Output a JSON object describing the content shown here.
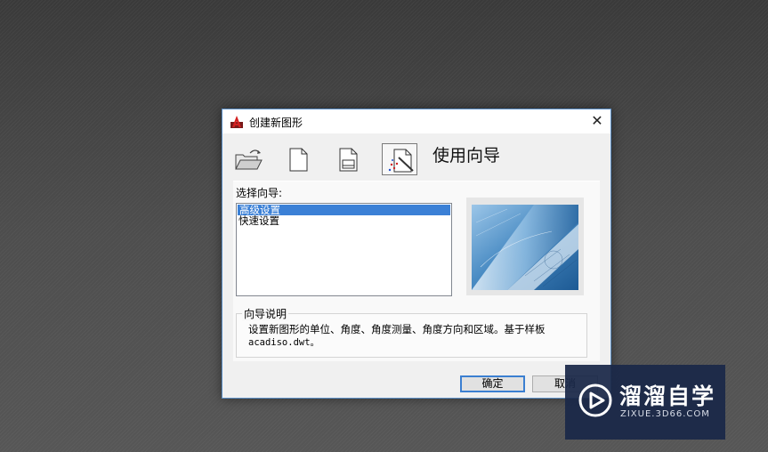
{
  "dialog": {
    "title": "创建新图形",
    "close_glyph": "✕",
    "mode_title": "使用向导",
    "toolbar": [
      {
        "icon": "open-folder-icon",
        "tooltip": "",
        "active": false
      },
      {
        "icon": "blank-document-icon",
        "tooltip": "",
        "active": false
      },
      {
        "icon": "template-document-icon",
        "tooltip": "",
        "active": false
      },
      {
        "icon": "wizard-icon",
        "tooltip": "",
        "active": true
      }
    ],
    "wizard_label": "选择向导:",
    "wizard_items": [
      "高级设置",
      "快速设置"
    ],
    "selected_index": 0,
    "description_label": "向导说明",
    "description_line1": "设置新图形的单位、角度、角度测量、角度方向和区域。基于样板",
    "description_line2": "acadiso.dwt。",
    "ok_label": "确定",
    "cancel_label": "取消"
  },
  "watermark": {
    "name": "溜溜自学",
    "url": "ZIXUE.3D66.COM"
  },
  "colors": {
    "selection": "#3b80d6",
    "dialog_border": "#5b8fc7",
    "watermark_bg": "#1a2848"
  }
}
